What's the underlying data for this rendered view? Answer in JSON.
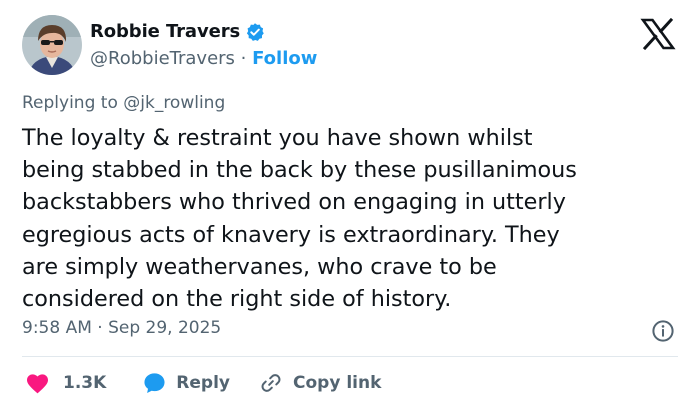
{
  "author": {
    "name": "Robbie Travers",
    "handle": "@RobbieTravers",
    "separator": " · ",
    "follow_label": "Follow",
    "verified": true,
    "verified_color": "#1d9bf0"
  },
  "reply_context": {
    "prefix": "Replying to ",
    "mention": "@jk_rowling"
  },
  "tweet": {
    "text": "The loyalty & restraint you have shown whilst\nbeing stabbed in the back by these pusillanimous\nbackstabbers who thrived on engaging in utterly\negregious acts of knavery is extraordinary. They\nare simply weathervanes, who crave to be\nconsidered on the right side of history.",
    "timestamp": "9:58 AM · Sep 29, 2025"
  },
  "actions": {
    "like_count": "1.3K",
    "reply_label": "Reply",
    "copy_link_label": "Copy link"
  },
  "icons": {
    "brand": "x-logo-icon",
    "verified": "verified-badge-icon",
    "info": "info-icon",
    "like": "heart-icon",
    "reply": "speech-bubble-icon",
    "copy": "link-icon"
  },
  "colors": {
    "text": "#0f1419",
    "secondary": "#536471",
    "accent": "#1d9bf0",
    "like": "#f91880"
  }
}
